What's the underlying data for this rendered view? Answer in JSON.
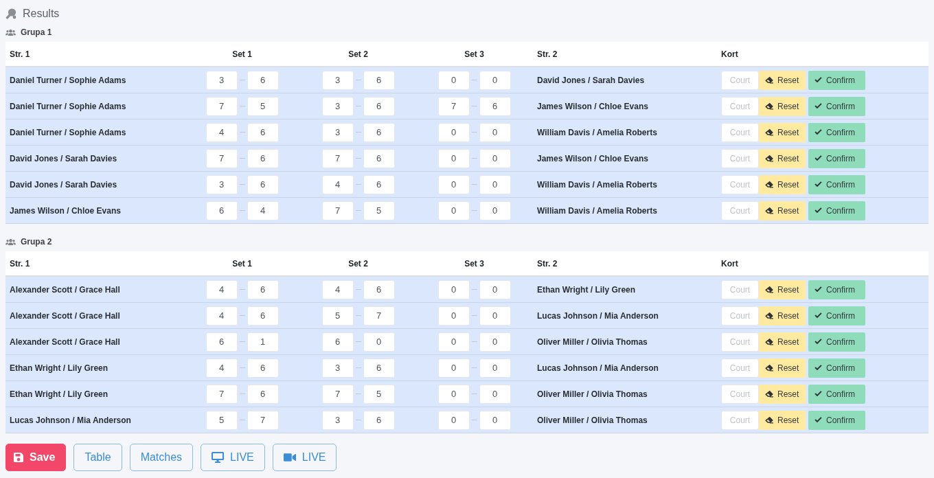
{
  "header": {
    "title": "Results"
  },
  "groups": [
    {
      "title": "Grupa 1",
      "columns": [
        "Str. 1",
        "Set 1",
        "Set 2",
        "Set 3",
        "Str. 2",
        "Kort"
      ],
      "matches": [
        {
          "team_1": "Daniel Turner / Sophie Adams",
          "sets": [
            {
              "score_1": "3",
              "score_2": "6"
            },
            {
              "score_1": "3",
              "score_2": "6"
            },
            {
              "score_1": "0",
              "score_2": "0"
            }
          ],
          "team_2": "David Jones / Sarah Davies",
          "court": {
            "placeholder": "Court"
          },
          "reset": "Reset",
          "confirm": "Confirm"
        },
        {
          "team_1": "Daniel Turner / Sophie Adams",
          "sets": [
            {
              "score_1": "7",
              "score_2": "5"
            },
            {
              "score_1": "3",
              "score_2": "6"
            },
            {
              "score_1": "7",
              "score_2": "6"
            }
          ],
          "team_2": "James Wilson / Chloe Evans",
          "court": {
            "placeholder": "Court"
          },
          "reset": "Reset",
          "confirm": "Confirm"
        },
        {
          "team_1": "Daniel Turner / Sophie Adams",
          "sets": [
            {
              "score_1": "4",
              "score_2": "6"
            },
            {
              "score_1": "3",
              "score_2": "6"
            },
            {
              "score_1": "0",
              "score_2": "0"
            }
          ],
          "team_2": "William Davis / Amelia Roberts",
          "court": {
            "placeholder": "Court"
          },
          "reset": "Reset",
          "confirm": "Confirm"
        },
        {
          "team_1": "David Jones / Sarah Davies",
          "sets": [
            {
              "score_1": "7",
              "score_2": "6"
            },
            {
              "score_1": "7",
              "score_2": "6"
            },
            {
              "score_1": "0",
              "score_2": "0"
            }
          ],
          "team_2": "James Wilson / Chloe Evans",
          "court": {
            "placeholder": "Court"
          },
          "reset": "Reset",
          "confirm": "Confirm"
        },
        {
          "team_1": "David Jones / Sarah Davies",
          "sets": [
            {
              "score_1": "3",
              "score_2": "6"
            },
            {
              "score_1": "4",
              "score_2": "6"
            },
            {
              "score_1": "0",
              "score_2": "0"
            }
          ],
          "team_2": "William Davis / Amelia Roberts",
          "court": {
            "placeholder": "Court"
          },
          "reset": "Reset",
          "confirm": "Confirm"
        },
        {
          "team_1": "James Wilson / Chloe Evans",
          "sets": [
            {
              "score_1": "6",
              "score_2": "4"
            },
            {
              "score_1": "7",
              "score_2": "5"
            },
            {
              "score_1": "0",
              "score_2": "0"
            }
          ],
          "team_2": "William Davis / Amelia Roberts",
          "court": {
            "placeholder": "Court"
          },
          "reset": "Reset",
          "confirm": "Confirm"
        }
      ]
    },
    {
      "title": "Grupa 2",
      "columns": [
        "Str. 1",
        "Set 1",
        "Set 2",
        "Set 3",
        "Str. 2",
        "Kort"
      ],
      "matches": [
        {
          "team_1": "Alexander Scott / Grace Hall",
          "sets": [
            {
              "score_1": "4",
              "score_2": "6"
            },
            {
              "score_1": "4",
              "score_2": "6"
            },
            {
              "score_1": "0",
              "score_2": "0"
            }
          ],
          "team_2": "Ethan Wright / Lily Green",
          "court": {
            "placeholder": "Court"
          },
          "reset": "Reset",
          "confirm": "Confirm"
        },
        {
          "team_1": "Alexander Scott / Grace Hall",
          "sets": [
            {
              "score_1": "4",
              "score_2": "6"
            },
            {
              "score_1": "5",
              "score_2": "7"
            },
            {
              "score_1": "0",
              "score_2": "0"
            }
          ],
          "team_2": "Lucas Johnson / Mia Anderson",
          "court": {
            "placeholder": "Court"
          },
          "reset": "Reset",
          "confirm": "Confirm"
        },
        {
          "team_1": "Alexander Scott / Grace Hall",
          "sets": [
            {
              "score_1": "6",
              "score_2": "1"
            },
            {
              "score_1": "6",
              "score_2": "0"
            },
            {
              "score_1": "0",
              "score_2": "0"
            }
          ],
          "team_2": "Oliver Miller / Olivia Thomas",
          "court": {
            "placeholder": "Court"
          },
          "reset": "Reset",
          "confirm": "Confirm"
        },
        {
          "team_1": "Ethan Wright / Lily Green",
          "sets": [
            {
              "score_1": "4",
              "score_2": "6"
            },
            {
              "score_1": "3",
              "score_2": "6"
            },
            {
              "score_1": "0",
              "score_2": "0"
            }
          ],
          "team_2": "Lucas Johnson / Mia Anderson",
          "court": {
            "placeholder": "Court"
          },
          "reset": "Reset",
          "confirm": "Confirm"
        },
        {
          "team_1": "Ethan Wright / Lily Green",
          "sets": [
            {
              "score_1": "7",
              "score_2": "6"
            },
            {
              "score_1": "7",
              "score_2": "5"
            },
            {
              "score_1": "0",
              "score_2": "0"
            }
          ],
          "team_2": "Oliver Miller / Olivia Thomas",
          "court": {
            "placeholder": "Court"
          },
          "reset": "Reset",
          "confirm": "Confirm"
        },
        {
          "team_1": "Lucas Johnson / Mia Anderson",
          "sets": [
            {
              "score_1": "5",
              "score_2": "7"
            },
            {
              "score_1": "3",
              "score_2": "6"
            },
            {
              "score_1": "0",
              "score_2": "0"
            }
          ],
          "team_2": "Oliver Miller / Olivia Thomas",
          "court": {
            "placeholder": "Court"
          },
          "reset": "Reset",
          "confirm": "Confirm"
        }
      ]
    }
  ],
  "actions": [
    {
      "kind": "save",
      "label": "Save"
    },
    {
      "kind": "plain",
      "label": "Table"
    },
    {
      "kind": "plain",
      "label": "Matches"
    },
    {
      "kind": "screen",
      "label": "LIVE"
    },
    {
      "kind": "camera",
      "label": "LIVE"
    }
  ]
}
